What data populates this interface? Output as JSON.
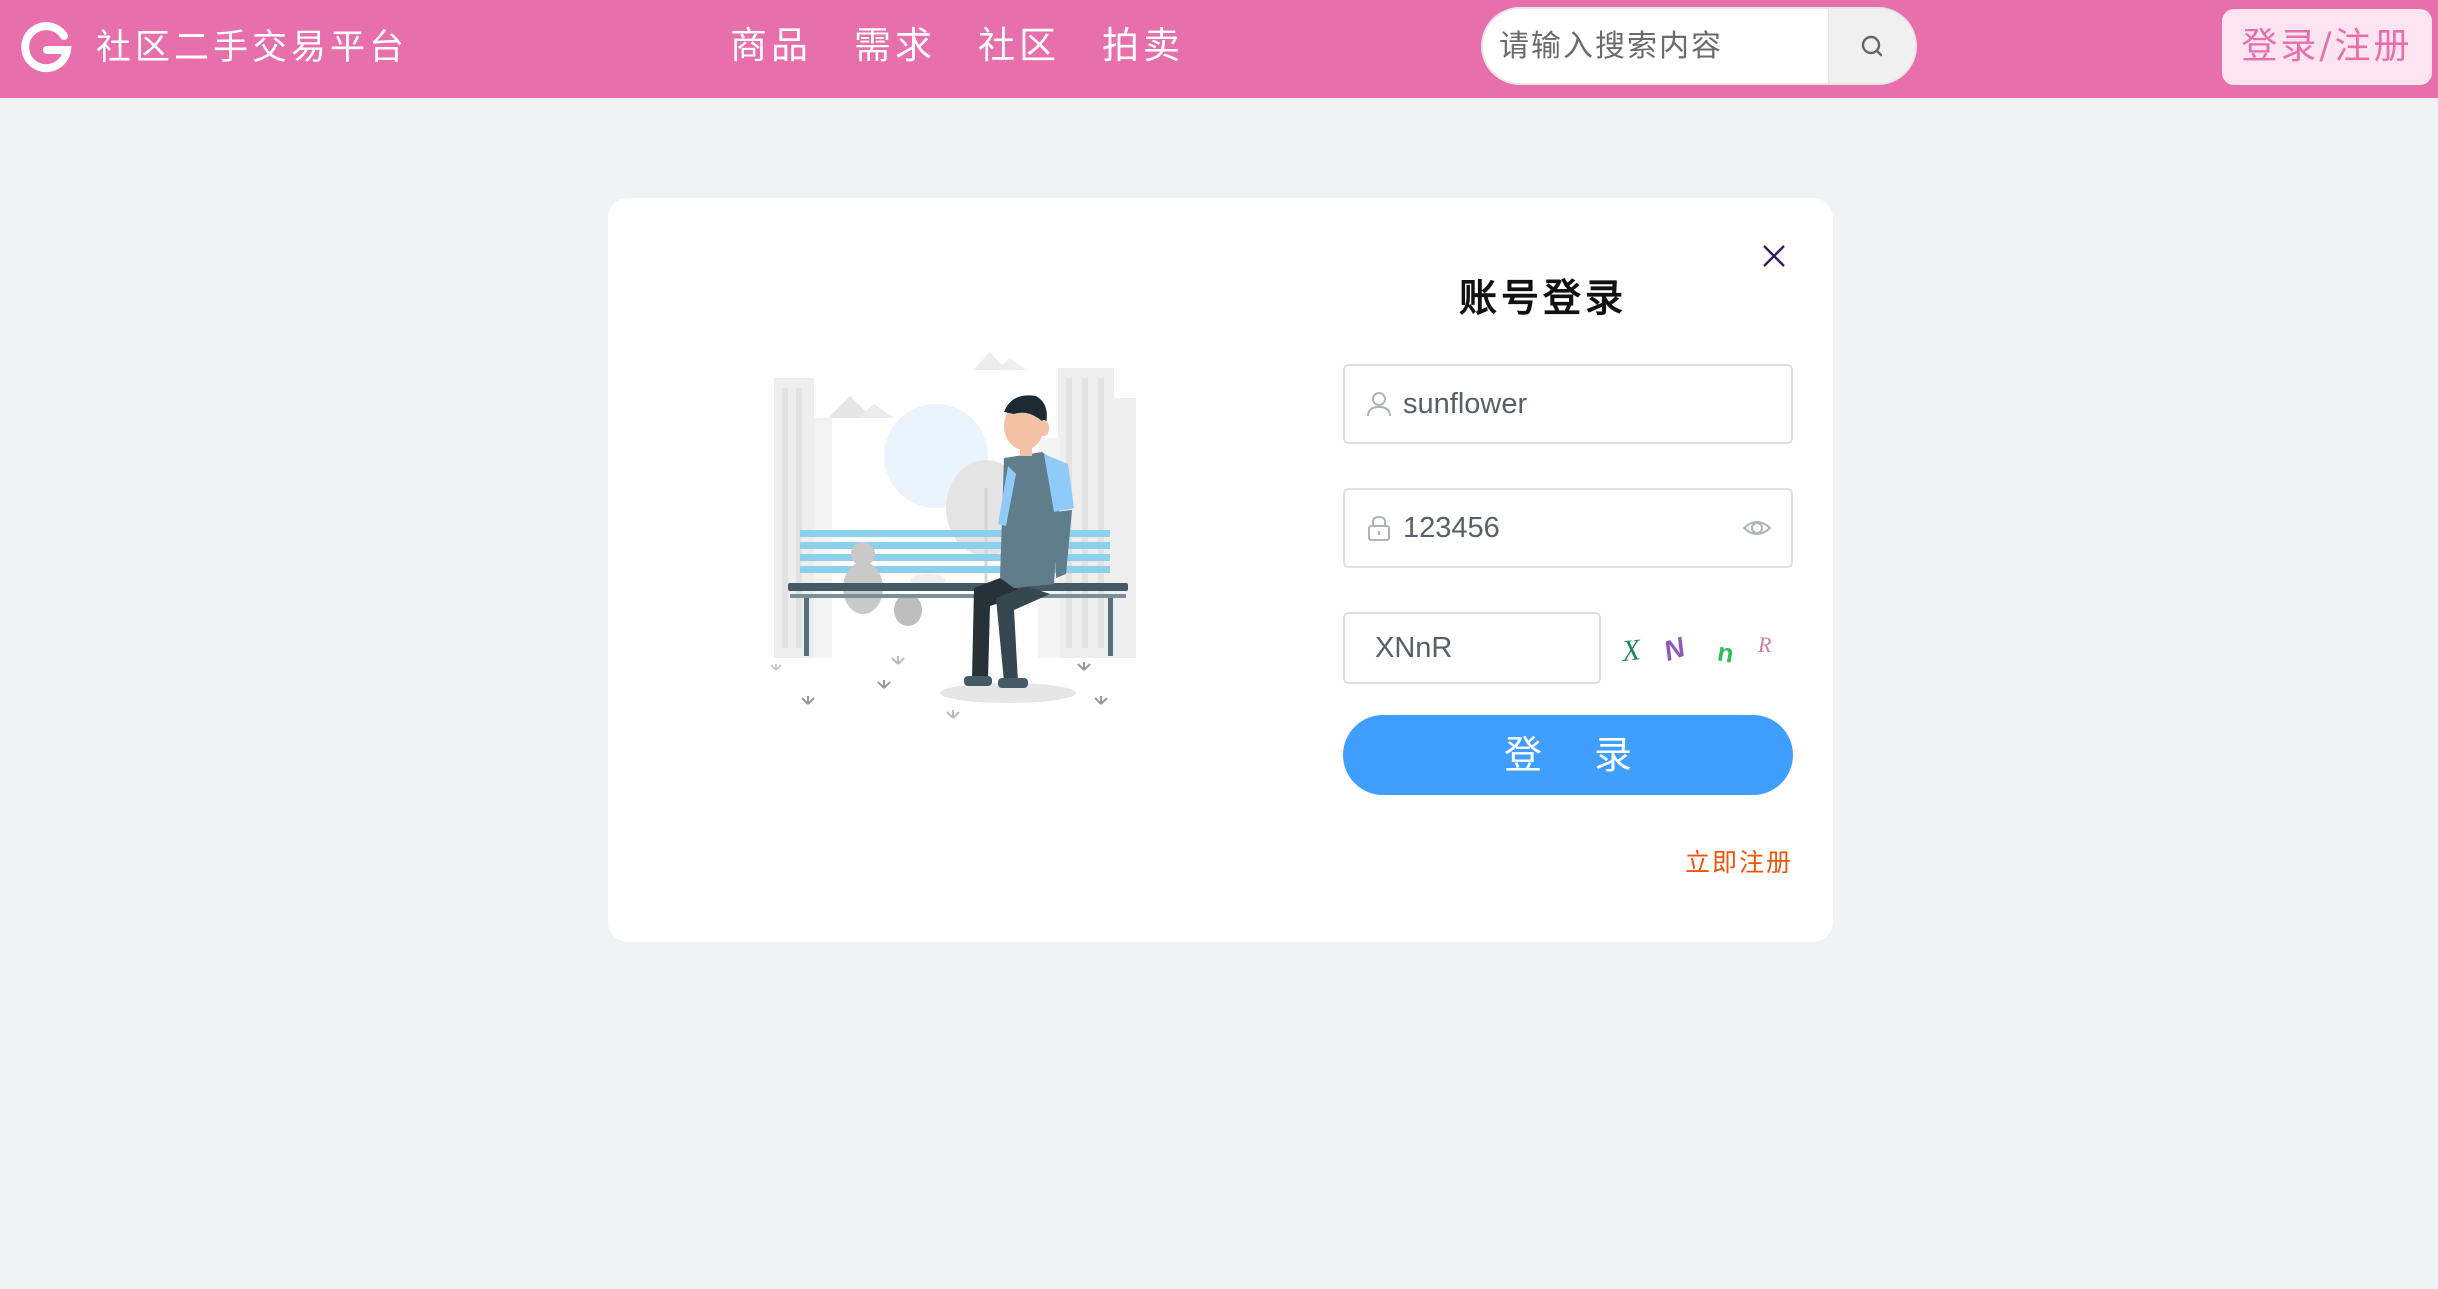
{
  "header": {
    "logo_icon": "g-logo-icon",
    "site_title": "社区二手交易平台",
    "nav": [
      {
        "label": "商品"
      },
      {
        "label": "需求"
      },
      {
        "label": "社区"
      },
      {
        "label": "拍卖"
      }
    ],
    "search": {
      "placeholder": "请输入搜索内容",
      "value": "",
      "icon": "search-icon"
    },
    "auth_button": "登录/注册"
  },
  "login_form": {
    "title": "账号登录",
    "username": {
      "value": "sunflower",
      "icon": "user-icon"
    },
    "password": {
      "value": "123456",
      "icon": "lock-icon",
      "toggle_icon": "eye-icon"
    },
    "captcha": {
      "value": "XNnR",
      "image_text": "XNnR"
    },
    "submit_label": "登 录",
    "register_link": "立即注册",
    "close_icon": "close-icon"
  },
  "colors": {
    "header_bg": "#e76fab",
    "primary": "#409eff",
    "link": "#f0540b",
    "page_bg": "#f1f2f4"
  }
}
